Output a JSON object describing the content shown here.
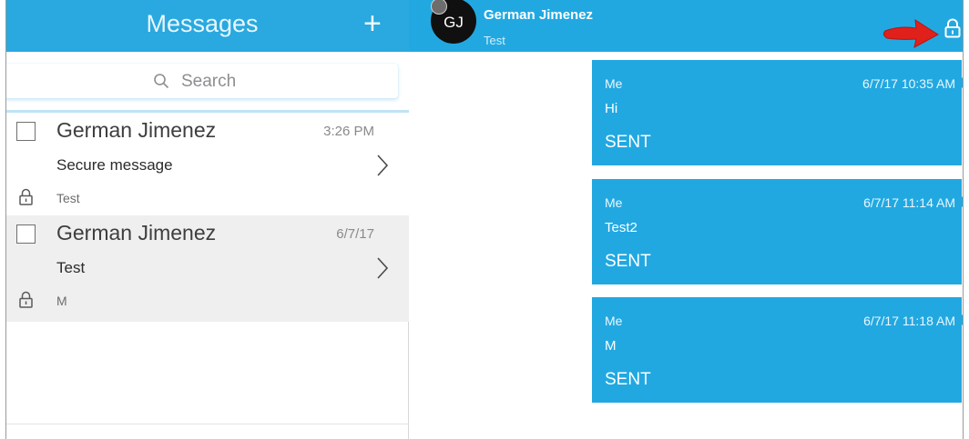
{
  "sidebar": {
    "title": "Messages",
    "new_icon": "plus-icon",
    "search": {
      "placeholder": "Search",
      "icon": "search-icon"
    },
    "conversations": [
      {
        "name": "German Jimenez",
        "time": "3:26 PM",
        "preview": "Secure message",
        "subtitle": "Test",
        "selected": false
      },
      {
        "name": "German Jimenez",
        "time": "6/7/17",
        "preview": "Test",
        "subtitle": "M",
        "selected": true
      }
    ]
  },
  "conversation": {
    "avatar_initials": "GJ",
    "contact_name": "German Jimenez",
    "subject": "Test",
    "lock_icon": "lock-icon",
    "annotation_icon": "red-arrow-icon",
    "messages": [
      {
        "sender": "Me",
        "timestamp": "6/7/17 10:35 AM",
        "text": "Hi",
        "status": "SENT"
      },
      {
        "sender": "Me",
        "timestamp": "6/7/17 11:14 AM",
        "text": "Test2",
        "status": "SENT"
      },
      {
        "sender": "Me",
        "timestamp": "6/7/17 11:18 AM",
        "text": "M",
        "status": "SENT"
      }
    ]
  },
  "colors": {
    "header_blue": "#29a9df",
    "bubble_blue": "#22a8e1",
    "selected_row": "#efefef",
    "annotation_red": "#e0201b"
  }
}
